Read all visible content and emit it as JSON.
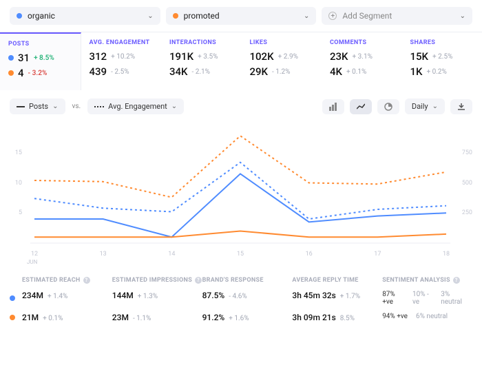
{
  "colors": {
    "organic": "#4f8cff",
    "promoted": "#ff8a30"
  },
  "segments": [
    {
      "key": "organic",
      "label": "organic"
    },
    {
      "key": "promoted",
      "label": "promoted"
    }
  ],
  "add_segment_label": "Add Segment",
  "metrics": [
    {
      "label": "POSTS",
      "active": true,
      "rows": [
        {
          "seg": "organic",
          "value": "31",
          "delta": "+ 8.5%",
          "dir": "up"
        },
        {
          "seg": "promoted",
          "value": "4",
          "delta": "- 3.2%",
          "dir": "down"
        }
      ]
    },
    {
      "label": "AVG. ENGAGEMENT",
      "active": false,
      "rows": [
        {
          "seg": "organic",
          "value": "312",
          "delta": "+ 10.2%"
        },
        {
          "seg": "promoted",
          "value": "439",
          "delta": "- 2.5%"
        }
      ]
    },
    {
      "label": "INTERACTIONS",
      "active": false,
      "rows": [
        {
          "seg": "organic",
          "value": "191K",
          "delta": "+ 3.5%"
        },
        {
          "seg": "promoted",
          "value": "34K",
          "delta": "- 2.1%"
        }
      ]
    },
    {
      "label": "LIKES",
      "active": false,
      "rows": [
        {
          "seg": "organic",
          "value": "102K",
          "delta": "+ 2.9%"
        },
        {
          "seg": "promoted",
          "value": "29K",
          "delta": "- 1.2%"
        }
      ]
    },
    {
      "label": "COMMENTS",
      "active": false,
      "rows": [
        {
          "seg": "organic",
          "value": "23K",
          "delta": "+ 3.1%"
        },
        {
          "seg": "promoted",
          "value": "4K",
          "delta": "+ 0.1%"
        }
      ]
    },
    {
      "label": "SHARES",
      "active": false,
      "rows": [
        {
          "seg": "organic",
          "value": "15K",
          "delta": "+ 2.5%"
        },
        {
          "seg": "promoted",
          "value": "1K",
          "delta": "+ 0.2%"
        }
      ]
    }
  ],
  "toolbar": {
    "metric_a": "Posts",
    "vs": "vs.",
    "metric_b": "Avg. Engagement",
    "granularity": "Daily"
  },
  "chart_data": {
    "type": "line",
    "xlabel": "JUN",
    "x": [
      12,
      13,
      14,
      15,
      16,
      17,
      18
    ],
    "y_left": {
      "label": "",
      "ticks": [
        5,
        10,
        15
      ]
    },
    "y_right": {
      "label": "",
      "ticks": [
        250,
        500,
        750
      ]
    },
    "series": [
      {
        "name": "organic posts",
        "axis": "left",
        "style": "solid",
        "color": "#4f8cff",
        "values": [
          4,
          4,
          1,
          11.5,
          3.5,
          4.5,
          5
        ]
      },
      {
        "name": "promoted posts",
        "axis": "left",
        "style": "solid",
        "color": "#ff8a30",
        "values": [
          1,
          1,
          1,
          2,
          1,
          1,
          1.5
        ]
      },
      {
        "name": "organic engagement",
        "axis": "right",
        "style": "dashed",
        "color": "#4f8cff",
        "values": [
          370,
          290,
          260,
          670,
          200,
          280,
          310
        ]
      },
      {
        "name": "promoted engagement",
        "axis": "right",
        "style": "dashed",
        "color": "#ff8a30",
        "values": [
          520,
          510,
          380,
          890,
          500,
          490,
          590
        ]
      }
    ]
  },
  "bottom": {
    "headers": [
      "ESTIMATED REACH",
      "ESTIMATED IMPRESSIONS",
      "BRAND'S RESPONSE",
      "AVERAGE REPLY TIME",
      "SENTIMENT ANALYSIS"
    ],
    "info_cols": [
      true,
      true,
      false,
      false,
      true
    ],
    "rows": [
      {
        "seg": "organic",
        "cells": [
          {
            "val": "234M",
            "d": "+ 1.4%"
          },
          {
            "val": "144M",
            "d": "+ 1.3%"
          },
          {
            "val": "87.5%",
            "d": "- 4.6%"
          },
          {
            "val": "3h 45m 32s",
            "d": "+ 1.7%"
          }
        ],
        "sentiment": {
          "pos": "87% +ve",
          "neg": "10% -ve",
          "neu": "3% neutral"
        }
      },
      {
        "seg": "promoted",
        "cells": [
          {
            "val": "21M",
            "d": "+ 0.1%"
          },
          {
            "val": "23M",
            "d": "- 1.1%"
          },
          {
            "val": "91.2%",
            "d": "+ 1.6%"
          },
          {
            "val": "3h 09m 21s",
            "d": "8.5%"
          }
        ],
        "sentiment": {
          "pos": "94% +ve",
          "neg": "",
          "neu": "6% neutral"
        }
      }
    ]
  }
}
